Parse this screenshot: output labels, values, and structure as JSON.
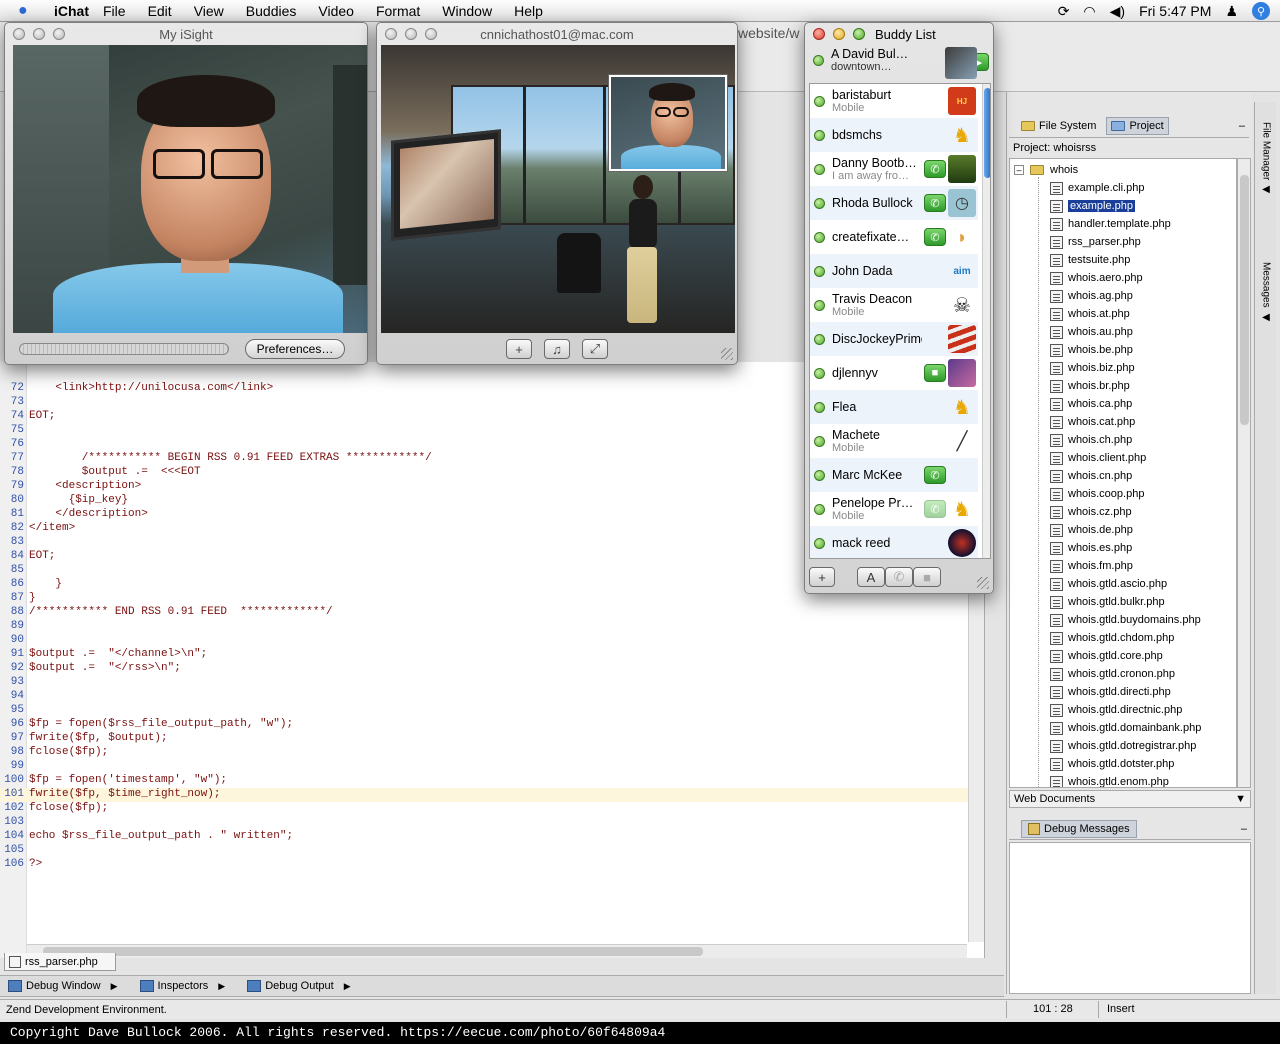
{
  "menubar": {
    "app_name": "iChat",
    "items": [
      "File",
      "Edit",
      "View",
      "Buddies",
      "Video",
      "Format",
      "Window",
      "Help"
    ],
    "clock": "Fri 5:47 PM"
  },
  "ide": {
    "address_fragment": "website/w",
    "editor": {
      "lines": [
        {
          "n": "72",
          "code": "    <link>http://unilocusa.com</link>"
        },
        {
          "n": "73",
          "code": ""
        },
        {
          "n": "74",
          "code": "EOT;"
        },
        {
          "n": "75",
          "code": ""
        },
        {
          "n": "76",
          "code": ""
        },
        {
          "n": "77",
          "code": "        /*********** BEGIN RSS 0.91 FEED EXTRAS ************/"
        },
        {
          "n": "78",
          "code": "        $output .=  <<<EOT"
        },
        {
          "n": "79",
          "code": "    <description>"
        },
        {
          "n": "80",
          "code": "      {$ip_key}"
        },
        {
          "n": "81",
          "code": "    </description>"
        },
        {
          "n": "82",
          "code": "</item>"
        },
        {
          "n": "83",
          "code": ""
        },
        {
          "n": "84",
          "code": "EOT;"
        },
        {
          "n": "85",
          "code": ""
        },
        {
          "n": "86",
          "code": "    }"
        },
        {
          "n": "87",
          "code": "}"
        },
        {
          "n": "88",
          "code": "/*********** END RSS 0.91 FEED  *************/"
        },
        {
          "n": "89",
          "code": ""
        },
        {
          "n": "90",
          "code": ""
        },
        {
          "n": "91",
          "code": "$output .=  \"</channel>\\n\";"
        },
        {
          "n": "92",
          "code": "$output .=  \"</rss>\\n\";"
        },
        {
          "n": "93",
          "code": ""
        },
        {
          "n": "94",
          "code": ""
        },
        {
          "n": "95",
          "code": ""
        },
        {
          "n": "96",
          "code": "$fp = fopen($rss_file_output_path, \"w\");"
        },
        {
          "n": "97",
          "code": "fwrite($fp, $output);"
        },
        {
          "n": "98",
          "code": "fclose($fp);"
        },
        {
          "n": "99",
          "code": ""
        },
        {
          "n": "100",
          "code": "$fp = fopen('timestamp', \"w\");"
        },
        {
          "n": "101",
          "code": "fwrite($fp, $time_right_now);"
        },
        {
          "n": "102",
          "code": "fclose($fp);"
        },
        {
          "n": "103",
          "code": ""
        },
        {
          "n": "104",
          "code": "echo $rss_file_output_path . \" written\";"
        },
        {
          "n": "105",
          "code": ""
        },
        {
          "n": "106",
          "code": "?>"
        }
      ],
      "highlight_line": "101"
    },
    "file_tab": "rss_parser.php",
    "bottom_tabs": [
      "Debug Window",
      "Inspectors",
      "Debug Output"
    ],
    "status_text": "Zend Development Environment.",
    "cursor_pos": "101 : 28",
    "edit_mode": "Insert",
    "project": {
      "tabs": [
        "File System",
        "Project"
      ],
      "label": "Project: whoisrss",
      "root": "whois",
      "files": [
        "example.cli.php",
        "example.php",
        "handler.template.php",
        "rss_parser.php",
        "testsuite.php",
        "whois.aero.php",
        "whois.ag.php",
        "whois.at.php",
        "whois.au.php",
        "whois.be.php",
        "whois.biz.php",
        "whois.br.php",
        "whois.ca.php",
        "whois.cat.php",
        "whois.ch.php",
        "whois.client.php",
        "whois.cn.php",
        "whois.coop.php",
        "whois.cz.php",
        "whois.de.php",
        "whois.es.php",
        "whois.fm.php",
        "whois.gtld.ascio.php",
        "whois.gtld.bulkr.php",
        "whois.gtld.buydomains.php",
        "whois.gtld.chdom.php",
        "whois.gtld.core.php",
        "whois.gtld.cronon.php",
        "whois.gtld.directi.php",
        "whois.gtld.directnic.php",
        "whois.gtld.domainbank.php",
        "whois.gtld.dotregistrar.php",
        "whois.gtld.dotster.php",
        "whois.gtld.enom.php"
      ],
      "selected_file": "example.php",
      "web_documents": "Web Documents",
      "debug_tab": "Debug Messages"
    },
    "side_tabs": [
      "File Manager",
      "Messages"
    ]
  },
  "isight": {
    "title": "My iSight",
    "preferences_label": "Preferences…"
  },
  "conference": {
    "title": "cnnichathost01@mac.com"
  },
  "buddy_list": {
    "title": "Buddy List",
    "me": {
      "name": "A David Bul…",
      "status": "downtown…"
    },
    "buddies": [
      {
        "name": "baristaburt",
        "sub": "Mobile",
        "av": "",
        "icon": "hungry-jacks-icon"
      },
      {
        "name": "bdsmchs",
        "sub": "",
        "av": "",
        "icon": "aim-runner-icon"
      },
      {
        "name": "Danny Bootb…",
        "sub": "I am away fro…",
        "av": "audio",
        "icon": "landscape-icon"
      },
      {
        "name": "Rhoda Bullock",
        "sub": "",
        "av": "audio",
        "icon": "clock-icon"
      },
      {
        "name": "createfixate…",
        "sub": "",
        "av": "audio",
        "icon": "fortune-cookie-icon"
      },
      {
        "name": "John  Dada",
        "sub": "",
        "av": "",
        "icon": "aim-logo-icon"
      },
      {
        "name": "Travis Deacon",
        "sub": "Mobile",
        "av": "",
        "icon": "skull-icon"
      },
      {
        "name": "DiscJockeyPrimo",
        "sub": "",
        "av": "",
        "icon": "flag-icon"
      },
      {
        "name": "djlennyv",
        "sub": "",
        "av": "video",
        "icon": "photo-icon"
      },
      {
        "name": "Flea",
        "sub": "",
        "av": "",
        "icon": "aim-runner-icon"
      },
      {
        "name": "Machete",
        "sub": "Mobile",
        "av": "",
        "icon": "blade-icon"
      },
      {
        "name": "Marc McKee",
        "sub": "",
        "av": "audio",
        "icon": ""
      },
      {
        "name": "Penelope Pr…",
        "sub": "Mobile",
        "av": "audio-dim",
        "icon": "aim-runner-icon"
      },
      {
        "name": "mack reed",
        "sub": "",
        "av": "",
        "icon": "orb-icon"
      }
    ],
    "foot_text_button": "A"
  },
  "copyright": "Copyright Dave Bullock 2006. All rights reserved. https://eecue.com/photo/60f64809a4"
}
